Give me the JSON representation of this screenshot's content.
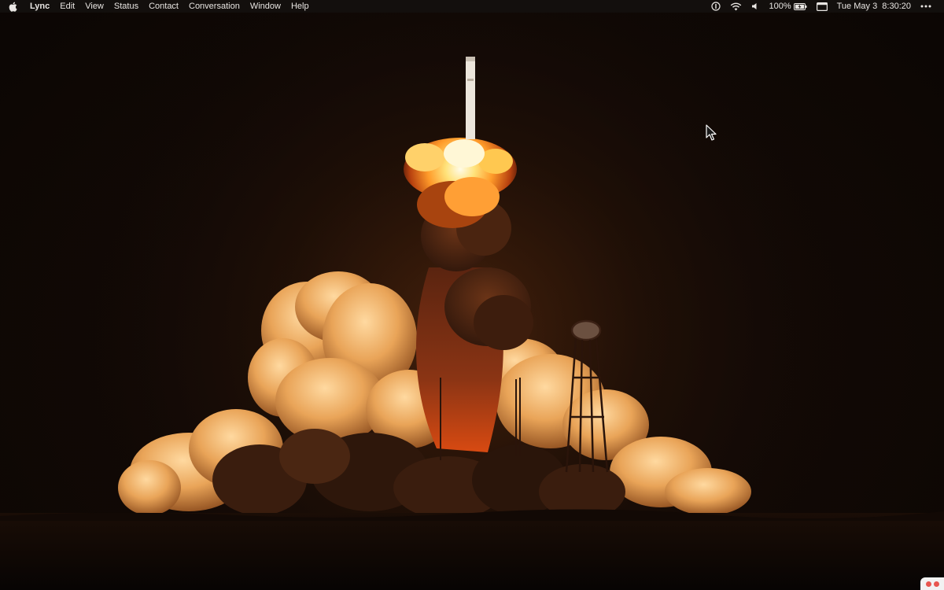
{
  "menubar": {
    "apple_icon": "apple-logo-icon",
    "app_name": "Lync",
    "menus": [
      "Edit",
      "View",
      "Status",
      "Contact",
      "Conversation",
      "Window",
      "Help"
    ],
    "status": {
      "info_icon": "info-icon",
      "wifi_icon": "wifi-icon",
      "volume_icon": "volume-icon",
      "battery_percent": "100%",
      "battery_icon": "battery-charging-icon",
      "window_icon": "window-icon",
      "datetime": "Tue May 3  8:30:20",
      "more_icon": "more-dots-icon"
    }
  },
  "wallpaper": {
    "subject": "rocket-launch-explosion",
    "colors": {
      "sky": "#0d0806",
      "fire": "#ffb84a",
      "smoke_light": "#e8a25a",
      "smoke_dark": "#3a1d0f",
      "ground": "#090504"
    }
  },
  "corner_badge": {
    "colors": [
      "#e8564f",
      "#e8564f"
    ]
  }
}
